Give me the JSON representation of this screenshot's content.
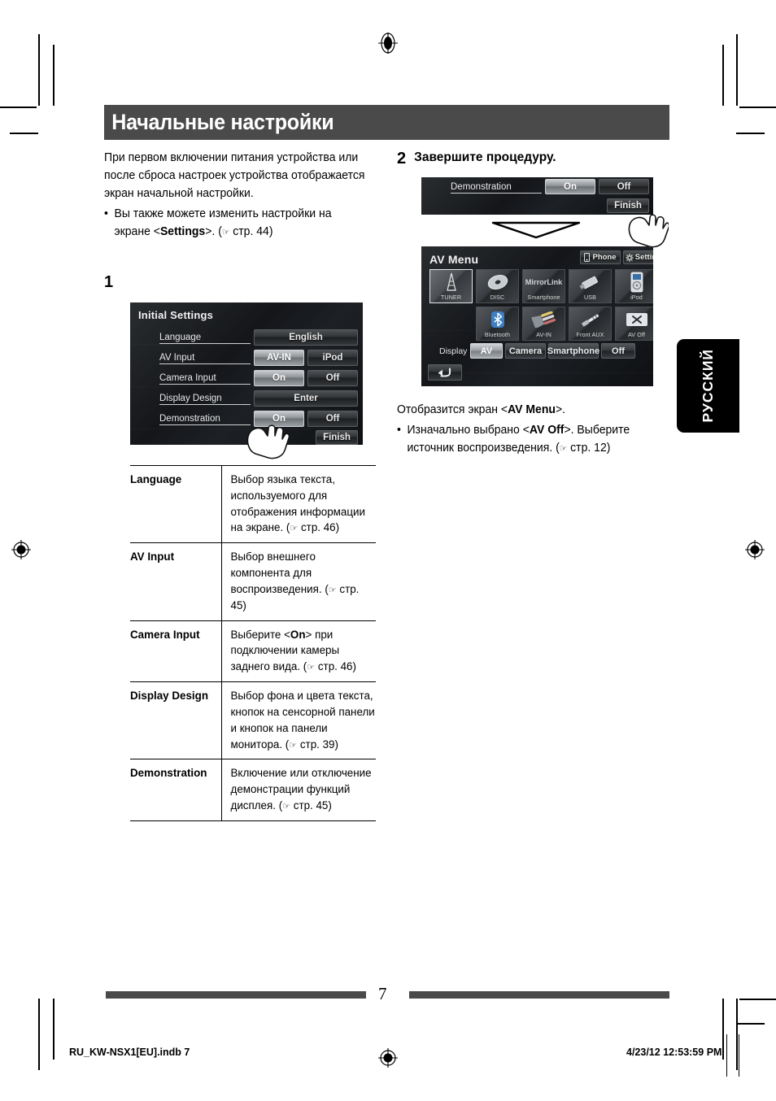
{
  "page": {
    "header_title": "Начальные настройки",
    "intro_paragraph": "При первом включении питания устройства или после сброса настроек устройства отображается экран начальной настройки.",
    "intro_bullet_prefix": "Вы также можете изменить настройки на экране <",
    "intro_bullet_bold": "Settings",
    "intro_bullet_suffix": ">. (",
    "intro_bullet_ref": " стр. 44)",
    "bullet_glyph": "•",
    "hand_glyph": "☞",
    "language_tab": "РУССКИЙ",
    "page_number": "7",
    "footer_file": "RU_KW-NSX1[EU].indb   7",
    "footer_date": "4/23/12   12:53:59 PM"
  },
  "step1": {
    "number": "1"
  },
  "step2": {
    "number": "2",
    "title": "Завершите процедуру.",
    "result_text_prefix": "Отобразится экран <",
    "result_text_bold": "AV Menu",
    "result_text_suffix": ">.",
    "bullet_prefix": "Изначально выбрано <",
    "bullet_bold": "AV Off",
    "bullet_mid": ">. Выберите источник воспроизведения. (",
    "bullet_ref": " стр. 12)"
  },
  "initial_settings_screen": {
    "title": "Initial Settings",
    "rows": [
      {
        "label": "Language",
        "buttons": [
          {
            "text": "English",
            "selected": false,
            "wide": true
          }
        ]
      },
      {
        "label": "AV Input",
        "buttons": [
          {
            "text": "AV-IN",
            "selected": true
          },
          {
            "text": "iPod",
            "selected": false
          }
        ]
      },
      {
        "label": "Camera Input",
        "buttons": [
          {
            "text": "On",
            "selected": true
          },
          {
            "text": "Off",
            "selected": false
          }
        ]
      },
      {
        "label": "Display Design",
        "buttons": [
          {
            "text": "Enter",
            "selected": false,
            "wide": true
          }
        ]
      },
      {
        "label": "Demonstration",
        "buttons": [
          {
            "text": "On",
            "selected": true
          },
          {
            "text": "Off",
            "selected": false
          }
        ]
      }
    ],
    "finish_button": "Finish"
  },
  "demonstration_screen": {
    "label": "Demonstration",
    "on_button": "On",
    "off_button": "Off",
    "finish_button": "Finish"
  },
  "av_menu_screen": {
    "title": "AV Menu",
    "phone_button": "Phone",
    "settings_button": "Settings",
    "sources_row1": [
      {
        "label": "TUNER",
        "icon": "tuner-icon",
        "selected": true
      },
      {
        "label": "DISC",
        "icon": "disc-icon",
        "selected": false
      },
      {
        "label": "Smartphone",
        "icon": "mirrorlink-icon",
        "selected": false,
        "icon_text": "MirrorLink"
      },
      {
        "label": "USB",
        "icon": "usb-icon",
        "selected": false
      },
      {
        "label": "iPod",
        "icon": "ipod-icon",
        "selected": false
      }
    ],
    "sources_row2": [
      {
        "label": "Bluetooth",
        "icon": "bluetooth-icon",
        "selected": false
      },
      {
        "label": "AV-IN",
        "icon": "av-in-icon",
        "selected": false
      },
      {
        "label": "Front AUX",
        "icon": "front-aux-icon",
        "selected": false
      },
      {
        "label": "AV Off",
        "icon": "av-off-icon",
        "selected": false
      }
    ],
    "display_label": "Display",
    "display_buttons": [
      {
        "text": "AV",
        "selected": true
      },
      {
        "text": "Camera",
        "selected": false
      },
      {
        "text": "Smartphone",
        "selected": false
      },
      {
        "text": "Off",
        "selected": false
      }
    ],
    "back_button": "back-arrow-icon"
  },
  "spec_table": {
    "rows": [
      {
        "key": "Language",
        "value": "Выбор языка текста, используемого для отображения информации на экране. (",
        "ref": " стр. 46)"
      },
      {
        "key": "AV Input",
        "value": "Выбор внешнего компонента для воспроизведения. (",
        "ref": " стр. 45)"
      },
      {
        "key": "Camera Input",
        "value_prefix": "Выберите <",
        "value_bold": "On",
        "value": "> при подключении камеры заднего вида. (",
        "ref": " стр. 46)"
      },
      {
        "key": "Display Design",
        "value": "Выбор фона и цвета текста, кнопок на сенсорной панели и кнопок на панели монитора. (",
        "ref": " стр. 39)"
      },
      {
        "key": "Demonstration",
        "value": "Включение или отключение демонстрации функций дисплея. (",
        "ref": " стр. 45)"
      }
    ]
  },
  "colors": {
    "header_band": "#4a4a4a",
    "footer_bar": "#4a4a4a",
    "tab_bg": "#000000"
  }
}
